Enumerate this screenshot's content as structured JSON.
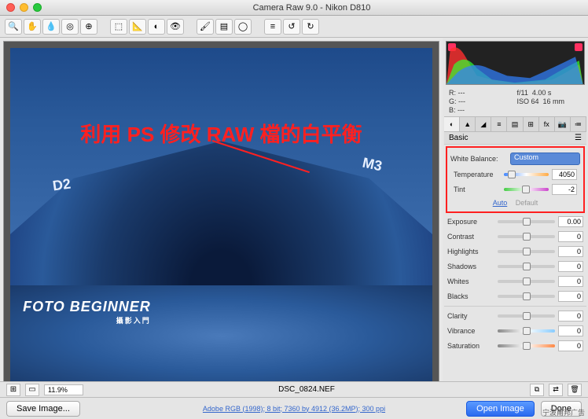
{
  "window": {
    "title": "Camera Raw 9.0 - Nikon D810"
  },
  "overlay": {
    "tutorial_text": "利用 PS 修改 RAW 檔的白平衡",
    "watermark_main": "FOTO BEGINNER",
    "watermark_sub": "攝影入門",
    "label_d2": "D2",
    "label_m3": "M3"
  },
  "exif": {
    "r": "R:",
    "r_val": "---",
    "g": "G:",
    "g_val": "---",
    "b": "B:",
    "b_val": "---",
    "aperture": "f/11",
    "shutter": "4.00 s",
    "iso": "ISO 64",
    "focal": "16 mm"
  },
  "panel": {
    "header": "Basic",
    "wb_label": "White Balance:",
    "wb_value": "Custom",
    "temp_label": "Temperature",
    "temp_value": "4050",
    "tint_label": "Tint",
    "tint_value": "-2",
    "auto": "Auto",
    "default": "Default",
    "exposure_label": "Exposure",
    "exposure_value": "0.00",
    "contrast_label": "Contrast",
    "contrast_value": "0",
    "highlights_label": "Highlights",
    "highlights_value": "0",
    "shadows_label": "Shadows",
    "shadows_value": "0",
    "whites_label": "Whites",
    "whites_value": "0",
    "blacks_label": "Blacks",
    "blacks_value": "0",
    "clarity_label": "Clarity",
    "clarity_value": "0",
    "vibrance_label": "Vibrance",
    "vibrance_value": "0",
    "saturation_label": "Saturation",
    "saturation_value": "0"
  },
  "bottom": {
    "zoom": "11.9%",
    "filename": "DSC_0824.NEF"
  },
  "footer": {
    "save": "Save Image...",
    "meta": "Adobe RGB (1998); 8 bit; 7360 by 4912 (36.2MP); 300 ppi",
    "open": "Open Image",
    "done": "Done",
    "corner": "宁波甬邦广告"
  }
}
